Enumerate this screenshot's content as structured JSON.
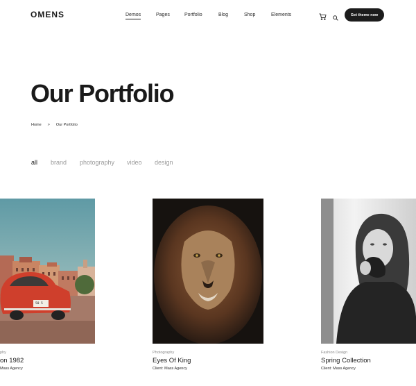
{
  "header": {
    "logo": "OMENS",
    "nav": [
      "Demos",
      "Pages",
      "Portfolio",
      "Blog",
      "Shop",
      "Elements"
    ],
    "active_nav": "Demos",
    "cta_label": "Get theme now",
    "icons": [
      "cart-icon",
      "search-icon"
    ]
  },
  "hero": {
    "title": "Our Portfolio",
    "breadcrumb": [
      "Home",
      ">",
      "Our Portfolio"
    ]
  },
  "filters": {
    "items": [
      "all",
      "brand",
      "photography",
      "video",
      "design"
    ],
    "active": "all"
  },
  "portfolio": [
    {
      "category": "phy",
      "title": "on 1982",
      "client_label": "Client:",
      "client": "Mass Agency"
    },
    {
      "category": "Photography",
      "title": "Eyes Of King",
      "client_label": "Client:",
      "client": "Mass Agency"
    },
    {
      "category": "Fashion Design",
      "title": "Spring Collection",
      "client_label": "Client:",
      "client": "Mass Agency"
    }
  ],
  "colors": {
    "text": "#1a1a1a",
    "muted": "#9a9a9a",
    "button_bg": "#1c1c1c",
    "background": "#ffffff"
  }
}
